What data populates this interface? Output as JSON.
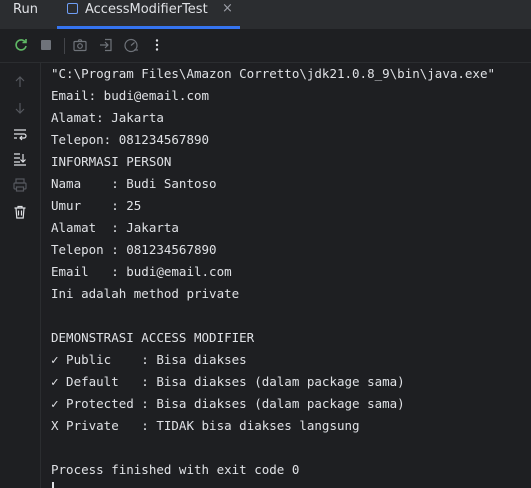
{
  "tabbar": {
    "run_label": "Run",
    "tab_title": "AccessModifierTest",
    "close_glyph": "×"
  },
  "toolbar": {
    "icons": [
      "rerun-icon",
      "stop-icon",
      "screenshot-icon",
      "login-icon",
      "gauge-icon",
      "more-vertical-icon"
    ]
  },
  "gutter": {
    "icons": [
      "arrow-up-icon",
      "arrow-down-icon",
      "soft-wrap-icon",
      "scroll-to-end-icon",
      "print-icon",
      "trash-icon"
    ]
  },
  "console": {
    "lines": [
      "\"C:\\Program Files\\Amazon Corretto\\jdk21.0.8_9\\bin\\java.exe\"",
      "Email: budi@email.com",
      "Alamat: Jakarta",
      "Telepon: 081234567890",
      "INFORMASI PERSON",
      "Nama    : Budi Santoso",
      "Umur    : 25",
      "Alamat  : Jakarta",
      "Telepon : 081234567890",
      "Email   : budi@email.com",
      "Ini adalah method private",
      "",
      "DEMONSTRASI ACCESS MODIFIER",
      "✓ Public    : Bisa diakses",
      "✓ Default   : Bisa diakses (dalam package sama)",
      "✓ Protected : Bisa diakses (dalam package sama)",
      "X Private   : TIDAK bisa diakses langsung",
      "",
      "Process finished with exit code 0"
    ]
  },
  "colors": {
    "background": "#1e1f22",
    "panel": "#2b2d30",
    "text": "#dfe1e5",
    "accent": "#3574f0",
    "rerun_green": "#5fb865",
    "icon_gray": "#6f737a"
  }
}
